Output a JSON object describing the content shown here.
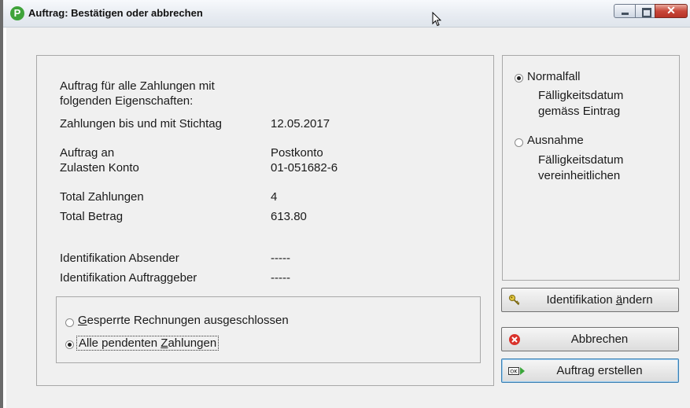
{
  "window": {
    "title": "Auftrag: Bestätigen oder abbrechen",
    "app_icon_letter": "P"
  },
  "main": {
    "intro_line1": "Auftrag für alle Zahlungen mit",
    "intro_line2": "folgenden Eigenschaften:",
    "rows": [
      {
        "label": "Zahlungen bis und mit Stichtag",
        "value": "12.05.2017"
      },
      {
        "label": "Auftrag an",
        "value": "Postkonto"
      },
      {
        "label": "Zulasten Konto",
        "value": "01-051682-6"
      },
      {
        "label": "Total Zahlungen",
        "value": "4"
      },
      {
        "label": "Total Betrag",
        "value": "613.80"
      },
      {
        "label": "Identifikation Absender",
        "value": "-----"
      },
      {
        "label": "Identifikation Auftraggeber",
        "value": "-----"
      }
    ],
    "filter": {
      "option1_prefix": "",
      "option1_mnemonic": "G",
      "option1_rest": "esperrte Rechnungen ausgeschlossen",
      "option2_prefix": "Alle pendenten ",
      "option2_mnemonic": "Z",
      "option2_rest": "ahlungen",
      "selected": "option2"
    }
  },
  "side": {
    "normal_label": "Normalfall",
    "normal_desc1": "Fälligkeitsdatum",
    "normal_desc2": "gemäss Eintrag",
    "exception_label": "Ausnahme",
    "exception_desc1": "Fälligkeitsdatum",
    "exception_desc2": "vereinheitlichen",
    "selected": "normal"
  },
  "buttons": {
    "identify_prefix": "Identifikation ",
    "identify_mnemonic": "ä",
    "identify_rest": "ndern",
    "cancel": "Abbrechen",
    "create": "Auftrag erstellen",
    "ok_icon_text": "OK"
  },
  "colors": {
    "panel_bg": "#f0f0f0",
    "close_red": "#c8473a",
    "cancel_icon_red": "#d9322b",
    "ok_arrow_green": "#3aa53a"
  },
  "icons": {
    "key": "key-icon",
    "cancel": "cancel-icon",
    "ok": "ok-arrow-icon"
  }
}
